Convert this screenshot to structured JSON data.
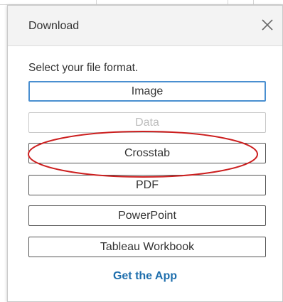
{
  "dialog": {
    "title": "Download",
    "instruction": "Select your file format.",
    "buttons": [
      {
        "label": "Image",
        "state": "focused"
      },
      {
        "label": "Data",
        "state": "disabled"
      },
      {
        "label": "Crosstab",
        "state": "highlighted"
      },
      {
        "label": "PDF",
        "state": "normal"
      },
      {
        "label": "PowerPoint",
        "state": "normal"
      },
      {
        "label": "Tableau Workbook",
        "state": "normal"
      }
    ],
    "link": "Get the App",
    "close_icon": "close-icon"
  },
  "colors": {
    "focus_border": "#4a8fd0",
    "link": "#1f6fad",
    "annotation": "#cc1f1f",
    "header_bg": "#f3f3f3"
  }
}
